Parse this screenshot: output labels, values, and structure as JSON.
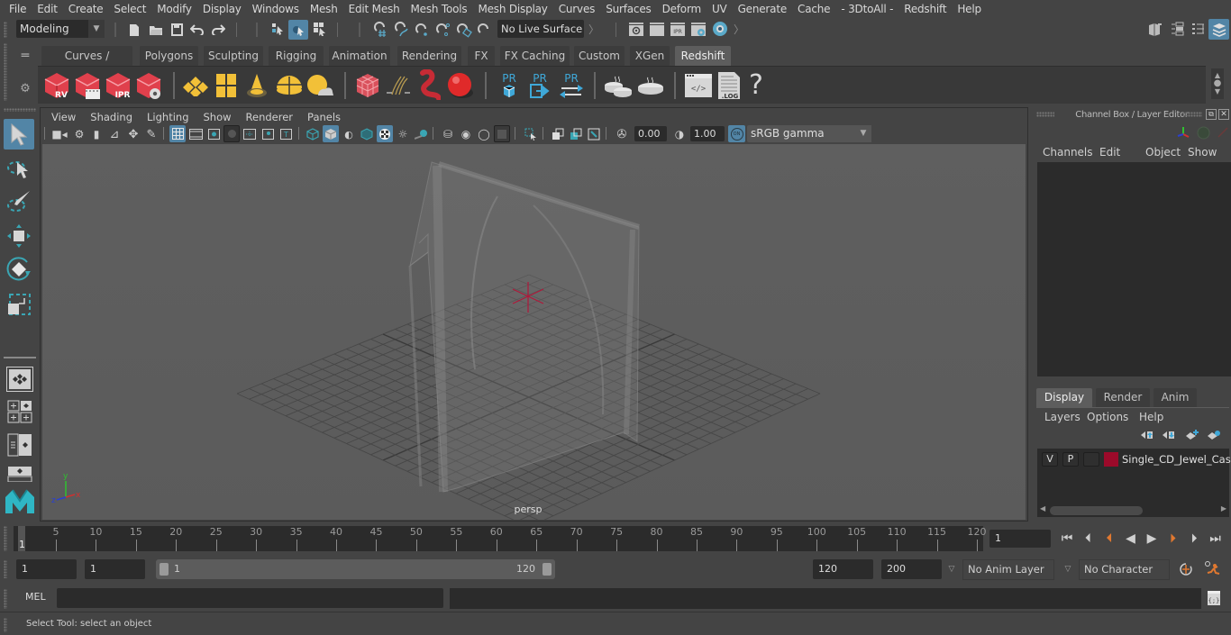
{
  "menubar": {
    "items": [
      "File",
      "Edit",
      "Create",
      "Select",
      "Modify",
      "Display",
      "Windows",
      "Mesh",
      "Edit Mesh",
      "Mesh Tools",
      "Mesh Display",
      "Curves",
      "Surfaces",
      "Deform",
      "UV",
      "Generate",
      "Cache",
      "- 3DtoAll -",
      "Redshift",
      "Help"
    ]
  },
  "statusline": {
    "workspace_mode": "Modeling",
    "live_surface": "No Live Surface",
    "icons": [
      "new-scene-icon",
      "open-scene-icon",
      "save-scene-icon",
      "undo-icon",
      "redo-icon",
      "select-by-hierarchy-icon",
      "select-by-object-icon",
      "select-by-component-icon",
      "snap-grid-icon",
      "snap-curve-icon",
      "snap-point-icon",
      "snap-view-plane-icon",
      "snap-surface-icon",
      "make-live-icon",
      "render-view-icon",
      "render-frame-icon",
      "ipr-render-icon",
      "render-settings-icon",
      "hypershade-icon"
    ],
    "right_icons": [
      "modeling-toolkit-icon",
      "attribute-editor-icon",
      "tool-settings-icon",
      "channel-box-layer-editor-icon"
    ]
  },
  "shelf": {
    "tabs": [
      "Curves / Surfaces",
      "Polygons",
      "Sculpting",
      "Rigging",
      "Animation",
      "Rendering",
      "FX",
      "FX Caching",
      "Custom",
      "XGen",
      "Redshift"
    ],
    "active_tab": "Redshift",
    "icon_labels": {
      "rv": "RV",
      "ipr": "IPR",
      "pr": "PR",
      "log": ".LOG",
      "help": "?"
    }
  },
  "toolbox": {
    "tools": [
      "select-tool",
      "lasso-tool",
      "paint-select-tool",
      "move-tool",
      "rotate-tool",
      "scale-tool"
    ],
    "layouts": [
      "single-perspective-layout",
      "four-view-layout",
      "outliner-persp-layout",
      "persp-graph-layout"
    ]
  },
  "viewport": {
    "menu": [
      "View",
      "Shading",
      "Lighting",
      "Show",
      "Renderer",
      "Panels"
    ],
    "exposure": "0.00",
    "gamma": "1.00",
    "color_mgmt_badge": "ON",
    "color_space": "sRGB gamma",
    "camera_label": "persp",
    "axis": {
      "x": "x",
      "y": "y",
      "z": "z"
    }
  },
  "channelbox": {
    "title": "Channel Box / Layer Editor",
    "menu": [
      "Channels",
      "Edit",
      "Object",
      "Show"
    ],
    "layer_tabs": [
      "Display",
      "Render",
      "Anim"
    ],
    "active_layer_tab": "Display",
    "layer_menu": [
      "Layers",
      "Options",
      "Help"
    ],
    "layers": [
      {
        "visible": "V",
        "playback": "P",
        "type": "",
        "color": "#9b0a2a",
        "name": "Single_CD_Jewel_Case"
      }
    ]
  },
  "timeline": {
    "ticks": [
      5,
      10,
      15,
      20,
      25,
      30,
      35,
      40,
      45,
      50,
      55,
      60,
      65,
      70,
      75,
      80,
      85,
      90,
      95,
      100,
      105,
      110,
      115,
      120
    ],
    "current_frame_marker": "1",
    "current_frame": "1",
    "playback_icons": [
      "go-to-start-icon",
      "step-back-icon",
      "step-back-key-icon",
      "play-backward-icon",
      "play-forward-icon",
      "step-forward-key-icon",
      "step-forward-icon",
      "go-to-end-icon"
    ]
  },
  "range": {
    "start_frame": "1",
    "playback_start": "1",
    "slider_start": "1",
    "slider_end": "120",
    "playback_end": "120",
    "end_frame": "200",
    "anim_layer": "No Anim Layer",
    "character_set": "No Character Set"
  },
  "cmdline": {
    "language": "MEL",
    "input": "",
    "result": ""
  },
  "helpline": {
    "text": "Select Tool: select an object"
  }
}
